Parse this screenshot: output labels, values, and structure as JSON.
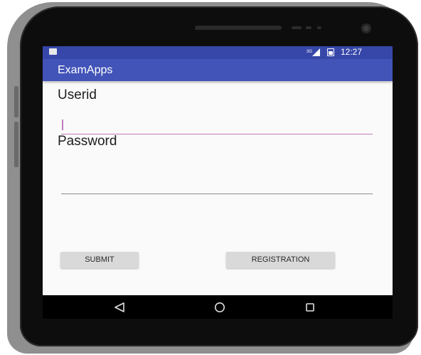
{
  "status_bar": {
    "time": "12:27",
    "signal_icon": "signal-icon",
    "battery_icon": "battery-icon",
    "notification_icon": "sd-card-icon"
  },
  "app_bar": {
    "title": "ExamApps"
  },
  "form": {
    "userid_label": "Userid",
    "userid_value": "",
    "password_label": "Password",
    "password_value": ""
  },
  "buttons": {
    "submit_label": "SUBMIT",
    "registration_label": "REGISTRATION"
  },
  "nav": {
    "back_icon": "back-icon",
    "home_icon": "home-icon",
    "recents_icon": "recents-icon"
  },
  "colors": {
    "status_bar": "#3747a9",
    "app_bar": "#4254b8",
    "accent": "#c07cc0",
    "button": "#d9d9d9"
  }
}
